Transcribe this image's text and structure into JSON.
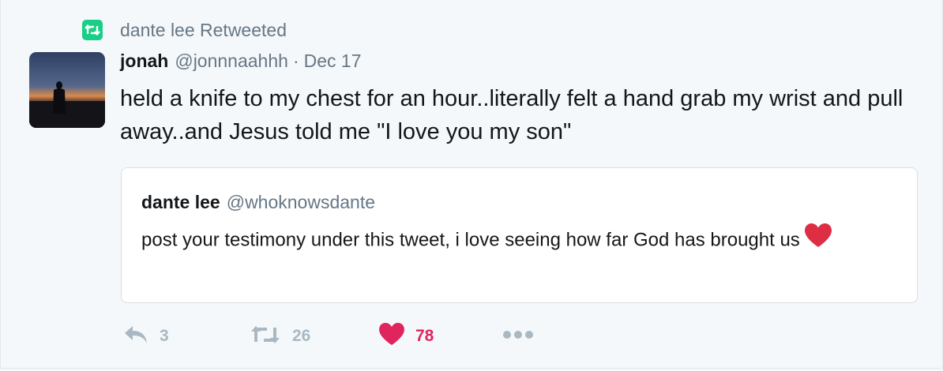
{
  "retweet_context": {
    "text": "dante lee Retweeted",
    "icon": "retweet-icon",
    "color": "#19cf86"
  },
  "tweet": {
    "author_name": "jonah",
    "author_handle": "@jonnnaahhh",
    "separator": "·",
    "date": "Dec 17",
    "text": "held a knife to my chest for an hour..literally felt a hand grab my wrist and pull away..and Jesus told me \"I love you my son\""
  },
  "quoted_tweet": {
    "author_name": "dante lee",
    "author_handle": "@whoknowsdante",
    "text": "post your testimony under this tweet, i love seeing how far God has brought us",
    "emoji": "red-heart"
  },
  "actions": {
    "reply_count": "3",
    "retweet_count": "26",
    "like_count": "78",
    "like_color": "#e0245e",
    "muted_color": "#aab8c2"
  }
}
